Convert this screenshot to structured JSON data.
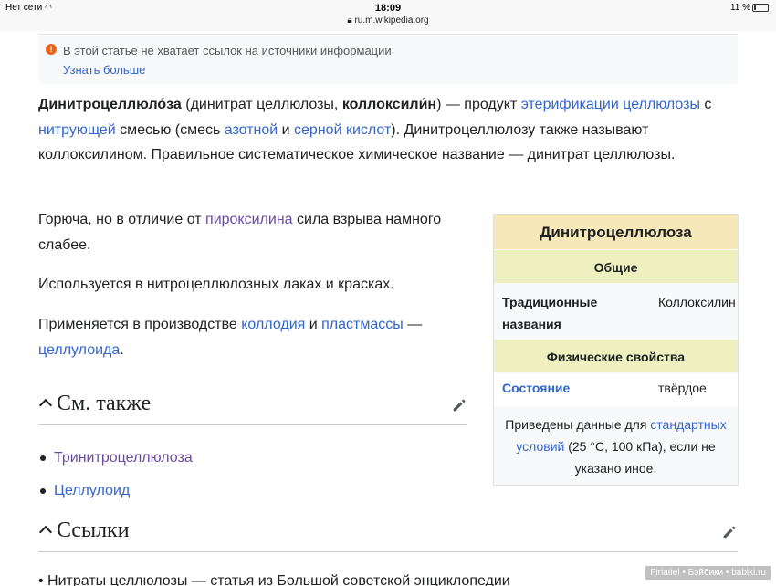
{
  "status_bar": {
    "carrier": "Нет сети",
    "time": "18:09",
    "url": "ru.m.wikipedia.org",
    "battery": "11 %"
  },
  "notice": {
    "text": "В этой статье не хватает ссылок на источники информации.",
    "link": "Узнать больше"
  },
  "article": {
    "p1": {
      "term": "Динитроцеллюло́за",
      "t1": " (динитрат целлюлозы, ",
      "alt": "коллоксили́н",
      "t2": ") — продукт ",
      "link1": "этерификации целлюлозы",
      "t3": " с ",
      "link2": "нитрующей",
      "t4": " смесью (смесь ",
      "link3": "азотной",
      "t5": " и ",
      "link4": "серной кислот",
      "t6": "). Динитроцеллюлозу также называют коллоксилином. Правильное систематическое химическое название — динитрат целлюлозы."
    },
    "p2": {
      "t1": "Горюча, но в отличие от ",
      "link1": "пироксилина",
      "t2": " сила взрыва намного слабее."
    },
    "p3": "Используется в нитроцеллюлозных лаках и красках.",
    "p4": {
      "t1": "Применяется в производстве ",
      "link1": "коллодия",
      "t2": " и ",
      "link2": "пластмассы",
      "t3": " — ",
      "link3": "целлулоида",
      "t4": "."
    }
  },
  "infobox": {
    "title": "Динитроцеллюлоза",
    "section1": "Общие",
    "row1_label": "Традиционные названия",
    "row1_value": "Коллоксилин",
    "section2": "Физические свойства",
    "row2_label": "Состояние",
    "row2_value": "твёрдое",
    "note_t1": "Приведены данные для ",
    "note_link": "стандартных условий",
    "note_t2": " (25 °C, 100 кПа), если не указано иное."
  },
  "see_also": {
    "title": "См. также",
    "items": [
      "Тринитроцеллюлоза",
      "Целлулоид"
    ]
  },
  "links_section": {
    "title": "Ссылки",
    "cut_text": "• Нитраты целлюлозы — статья из Большой советской энциклопедии"
  },
  "watermark": "Firiatiel • Бэйбики • babiki.ru"
}
